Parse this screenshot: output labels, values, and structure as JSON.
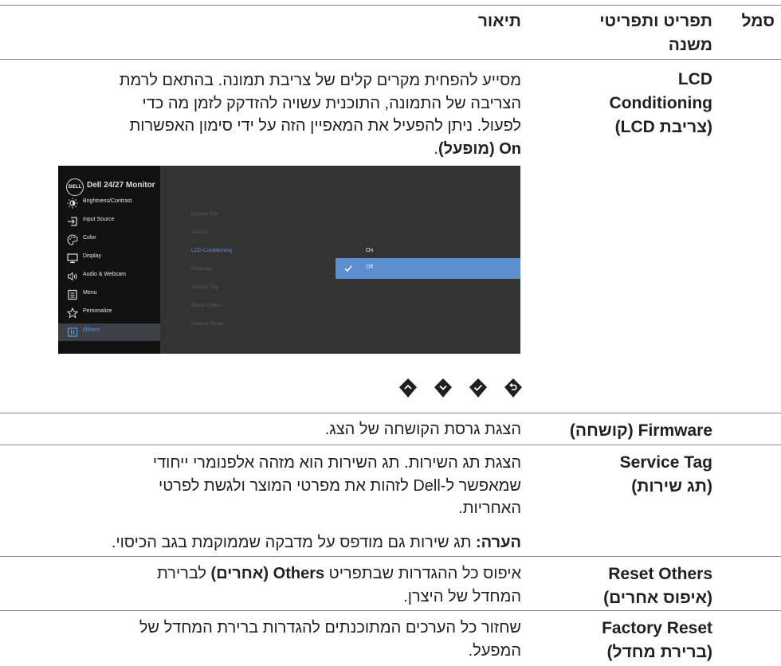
{
  "table": {
    "headers": {
      "symbol": "סמל",
      "menu": [
        "תפריט ותפריטי",
        "משנה"
      ],
      "description": "תיאור"
    },
    "lcd": {
      "name": [
        "LCD",
        "Conditioning",
        "(צריבת LCD)"
      ],
      "desc": [
        "מסייע להפחית מקרים קלים של צריבת תמונה. בהתאם לרמת",
        "הצריבה של התמונה, התוכנית עשויה להזדקק לזמן מה כדי",
        "לפעול. ניתן להפעיל את המאפיין הזה על ידי סימון האפשרות"
      ],
      "desc_bold": "On (מופעל)",
      "desc_end": "."
    },
    "firmware": {
      "name_en": "Firmware",
      "name_he": "(קושחה)",
      "desc": "הצגת גרסת הקושחה של הצג."
    },
    "service_tag": {
      "name": [
        "Service Tag",
        "(תג שירות)"
      ],
      "desc": [
        "הצגת תג השירות. תג השירות הוא מזהה אלפנומרי ייחודי",
        "שמאפשר ל-Dell לזהות את מפרטי המוצר ולגשת לפרטי",
        "האחריות."
      ],
      "note_label": "הערה:",
      "note": "תג שירות גם מודפס על מדבקה שממוקמת בגב הכיסוי."
    },
    "reset_others": {
      "name": [
        "Reset Others",
        "(איפוס אחרים)"
      ],
      "desc_pre": "איפוס כל ההגדרות שבתפריט",
      "desc_bold": "Others (אחרים)",
      "desc_post": "לברירת",
      "desc_line2": "המחדל של היצרן."
    },
    "factory_reset": {
      "name": [
        "Factory Reset",
        "(ברירת מחדל)"
      ],
      "desc": [
        "שחזור כל הערכים המתוכנתים להגדרות ברירת המחדל של",
        "המפעל."
      ]
    }
  },
  "osd": {
    "logo": "DELL",
    "title": "Dell 24/27 Monitor",
    "menu": [
      {
        "label": "Brightness/Contrast",
        "icon": "brightness-icon"
      },
      {
        "label": "Input Source",
        "icon": "input-source-icon"
      },
      {
        "label": "Color",
        "icon": "color-icon"
      },
      {
        "label": "Display",
        "icon": "display-icon"
      },
      {
        "label": "Audio & Webcam",
        "icon": "audio-webcam-icon"
      },
      {
        "label": "Menu",
        "icon": "menu-icon"
      },
      {
        "label": "Personalize",
        "icon": "star-icon"
      },
      {
        "label": "Others",
        "icon": "others-icon",
        "selected": true
      }
    ],
    "submenu": [
      "Display Info",
      "DDC/CI",
      "LCD Conditioning",
      "Firmware",
      "Service Tag",
      "Reset Others",
      "Factory Reset"
    ],
    "options": [
      "On",
      "Off"
    ],
    "selected_option": "Off",
    "nav_buttons": [
      "up-icon",
      "down-icon",
      "check-icon",
      "back-icon"
    ],
    "colors": {
      "accent": "#5b8fd0",
      "panel": "#333333",
      "sidebar": "#111111"
    }
  }
}
